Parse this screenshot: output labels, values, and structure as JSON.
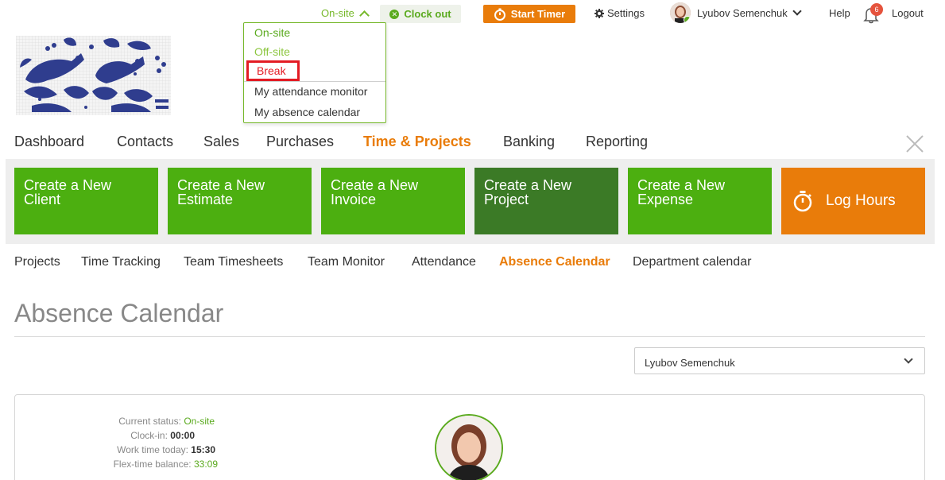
{
  "topbar": {
    "status": "On-site",
    "clock_out": "Clock out",
    "start_timer": "Start Timer",
    "settings": "Settings",
    "user_name": "Lyubov Semenchuk",
    "help": "Help",
    "notifications_count": "6",
    "logout": "Logout"
  },
  "status_menu": {
    "items": [
      "On-site",
      "Off-site",
      "Break"
    ],
    "links": [
      "My attendance monitor",
      "My absence calendar"
    ]
  },
  "main_nav": {
    "items": [
      "Dashboard",
      "Contacts",
      "Sales",
      "Purchases",
      "Time & Projects",
      "Banking",
      "Reporting"
    ],
    "active": "Time & Projects"
  },
  "quick_actions": {
    "client": "Create a New Client",
    "estimate": "Create a New Estimate",
    "invoice": "Create a New Invoice",
    "project": "Create a New Project",
    "expense": "Create a New Expense",
    "log_hours": "Log Hours"
  },
  "sub_nav": {
    "items": [
      "Projects",
      "Time Tracking",
      "Team Timesheets",
      "Team Monitor",
      "Attendance",
      "Absence Calendar",
      "Department calendar"
    ],
    "active": "Absence Calendar"
  },
  "page": {
    "title": "Absence Calendar",
    "selected_user": "Lyubov Semenchuk"
  },
  "summary": {
    "current_status_label": "Current status:",
    "current_status": "On-site",
    "clock_in_label": "Clock-in:",
    "clock_in": "00:00",
    "work_time_label": "Work time today:",
    "work_time": "15:30",
    "flex_label": "Flex-time balance:",
    "flex": "33:09"
  },
  "colors": {
    "accent_green": "#4caf10",
    "dark_green": "#3b7a26",
    "accent_orange": "#e97c0a",
    "highlight_red": "#e31b23"
  }
}
